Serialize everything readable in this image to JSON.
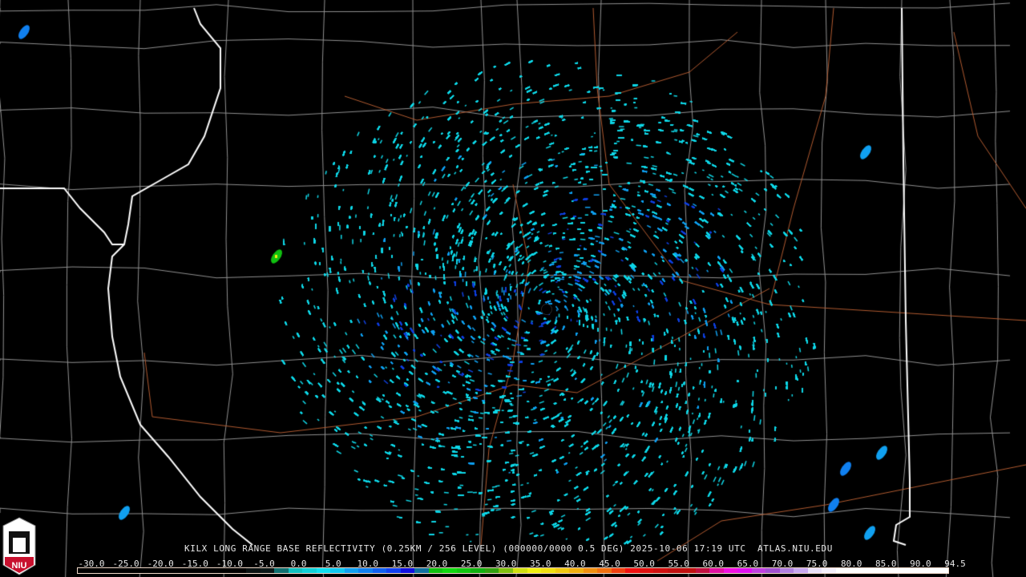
{
  "product": {
    "title": "KILX LONG RANGE BASE REFLECTIVITY (0.25KM / 256 LEVEL) (000000/0000 0.5 DEG) 2025-10-06 17:19 UTC  ATLAS.NIU.EDU",
    "station": "KILX",
    "timestamp": "2025-10-06 17:19 UTC",
    "source": "ATLAS.NIU.EDU"
  },
  "logo": {
    "text": "NIU"
  },
  "colorbar": {
    "min": -30,
    "max": 94.5,
    "labels": [
      "-30.0",
      "-25.0",
      "-20.0",
      "-15.0",
      "-10.0",
      "-5.0",
      "0.0",
      "5.0",
      "10.0",
      "15.0",
      "20.0",
      "25.0",
      "30.0",
      "35.0",
      "40.0",
      "45.0",
      "50.0",
      "55.0",
      "60.0",
      "65.0",
      "70.0",
      "75.0",
      "80.0",
      "85.0",
      "90.0",
      "94.5"
    ],
    "colors": [
      "#000000",
      "#000000",
      "#000000",
      "#000000",
      "#000000",
      "#000000",
      "#000000",
      "#000000",
      "#000000",
      "#000000",
      "#000000",
      "#000000",
      "#0a1212",
      "#0a1818",
      "#107070",
      "#10c0c0",
      "#10d0d8",
      "#10e0f0",
      "#10c8f0",
      "#10a0f0",
      "#1080f0",
      "#1060f0",
      "#1040f0",
      "#1010e0",
      "#1070a0",
      "#10c010",
      "#10d810",
      "#10c810",
      "#10b010",
      "#30a010",
      "#80c010",
      "#d0e010",
      "#f0f010",
      "#f0e010",
      "#f0c810",
      "#f0b010",
      "#f09010",
      "#f07010",
      "#f04010",
      "#f01010",
      "#e01010",
      "#d01010",
      "#c01010",
      "#c01010",
      "#c01040",
      "#e010a0",
      "#f010e0",
      "#e010f0",
      "#c040e0",
      "#a050d0",
      "#b080e0",
      "#c8a8f0",
      "#e8e0f8",
      "#f4f0fc",
      "#ffffff",
      "#ffffff",
      "#ffffff",
      "#ffffff",
      "#ffffff",
      "#ffffff",
      "#ffffff",
      "#ffffff"
    ]
  },
  "colors": {
    "state_border": "#ffffff",
    "county_border": "#909090",
    "road": "#b05a30",
    "echo_light": "#10d8e8",
    "echo_mid": "#10a0f0",
    "echo_dark": "#1040e0"
  }
}
